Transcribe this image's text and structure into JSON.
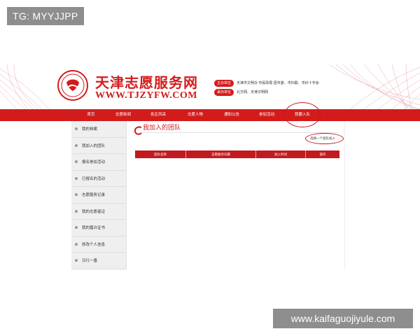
{
  "watermarks": {
    "top": "TG: MYYJJPP",
    "bottom": "www.kaifaguojiyule.com"
  },
  "site": {
    "name": "天津志愿服务网",
    "url": "WWW.TJZYFW.COM",
    "logo_icon": "volunteer-heart-logo"
  },
  "info": [
    {
      "label": "主办单位",
      "text": "天津市文明办 市民政局 团市委、市妇联、市红十字会"
    },
    {
      "label": "承办单位",
      "text": "北方网、天津文明网"
    }
  ],
  "nav": {
    "items": [
      "首页",
      "志愿新闻",
      "各区风采",
      "志愿人物",
      "通知公告",
      "参加活动",
      "我要入队"
    ]
  },
  "sidebar": {
    "items": [
      "我的档案",
      "我加入的团队",
      "报名参加活动",
      "已报名的活动",
      "志愿服务记录",
      "我的志愿者证",
      "我的嘉许证书",
      "修改个人信息",
      "日行一善"
    ]
  },
  "main": {
    "title": "我加入的团队",
    "join_button": "选择一个团队加入",
    "table_headers": [
      "团队名称",
      "志愿服务归属",
      "加入时间",
      "操作"
    ]
  },
  "colors": {
    "brand_red": "#d21c1c",
    "annotation_red": "#c8161d"
  }
}
